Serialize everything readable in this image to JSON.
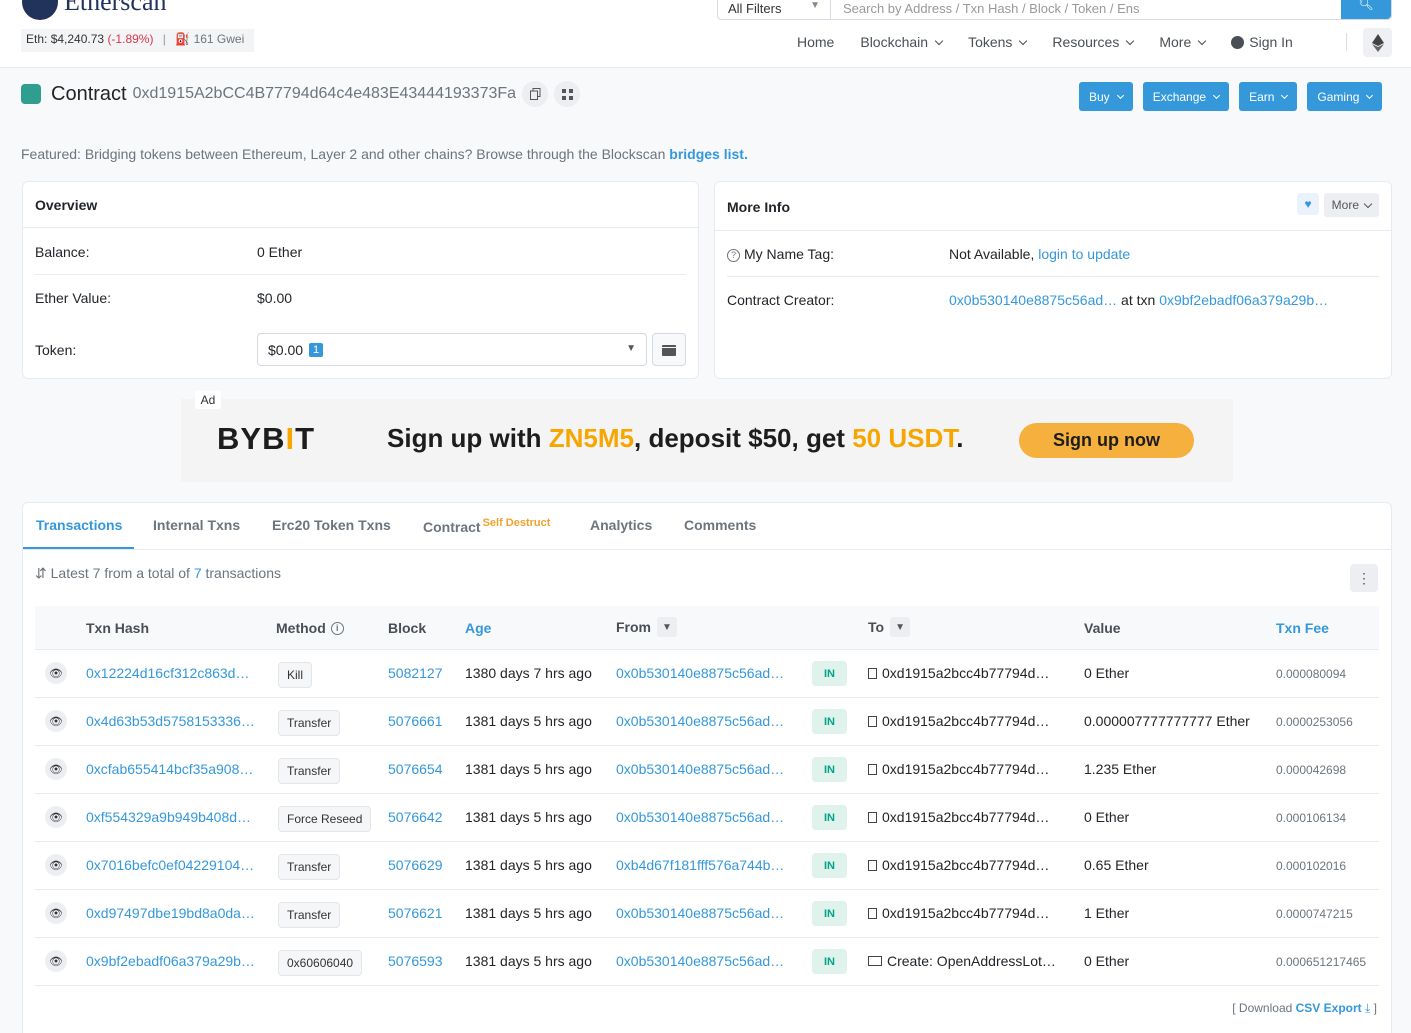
{
  "header": {
    "logo_text": "Etherscan",
    "eth_price_label": "Eth:",
    "eth_price": "$4,240.73",
    "eth_change": "(-1.89%)",
    "gas": "161 Gwei",
    "search_filter": "All Filters",
    "search_placeholder": "Search by Address / Txn Hash / Block / Token / Ens",
    "nav": [
      "Home",
      "Blockchain",
      "Tokens",
      "Resources",
      "More",
      "Sign In"
    ]
  },
  "page": {
    "title_label": "Contract",
    "address": "0xd1915A2bCC4B77794d64c4e483E43444193373Fa",
    "buttons": [
      "Buy",
      "Exchange",
      "Earn",
      "Gaming"
    ],
    "featured_text": "Featured: Bridging tokens between Ethereum, Layer 2 and other chains? Browse through the Blockscan",
    "featured_link": "bridges list."
  },
  "overview": {
    "title": "Overview",
    "balance_label": "Balance:",
    "balance": "0 Ether",
    "ether_value_label": "Ether Value:",
    "ether_value": "$0.00",
    "token_label": "Token:",
    "token_value": "$0.00",
    "token_count": "1"
  },
  "more_info": {
    "title": "More Info",
    "more_label": "More",
    "name_tag_label": "My Name Tag:",
    "name_tag_value": "Not Available,",
    "name_tag_link": "login to update",
    "creator_label": "Contract Creator:",
    "creator_address": "0x0b530140e8875c56ad…",
    "creator_at": "at txn",
    "creator_txn": "0x9bf2ebadf06a379a29b…"
  },
  "ad": {
    "label": "Ad",
    "brand": "BYB",
    "brand_i": "I",
    "brand_t": "T",
    "headline_1": "Sign up with ",
    "headline_code": "ZN5M5",
    "headline_2": ", deposit $50, get ",
    "headline_amount": "50 USDT",
    "headline_3": ".",
    "cta": "Sign up now"
  },
  "tabs": [
    {
      "label": "Transactions",
      "active": true
    },
    {
      "label": "Internal Txns"
    },
    {
      "label": "Erc20 Token Txns"
    },
    {
      "label": "Contract",
      "sup": "Self Destruct"
    },
    {
      "label": "Analytics"
    },
    {
      "label": "Comments"
    }
  ],
  "summary": {
    "prefix": "Latest 7 from a total of",
    "count": "7",
    "suffix": "transactions"
  },
  "table": {
    "headers": {
      "hash": "Txn Hash",
      "method": "Method",
      "block": "Block",
      "age": "Age",
      "from": "From",
      "to": "To",
      "value": "Value",
      "fee": "Txn Fee"
    },
    "rows": [
      {
        "hash": "0x12224d16cf312c863d…",
        "method": "Kill",
        "block": "5082127",
        "age": "1380 days 7 hrs ago",
        "from": "0x0b530140e8875c56ad…",
        "dir": "IN",
        "to": "0xd1915a2bcc4b77794d…",
        "value": "0 Ether",
        "fee": "0.000080094"
      },
      {
        "hash": "0x4d63b53d5758153336…",
        "method": "Transfer",
        "block": "5076661",
        "age": "1381 days 5 hrs ago",
        "from": "0x0b530140e8875c56ad…",
        "dir": "IN",
        "to": "0xd1915a2bcc4b77794d…",
        "value": "0.000007777777777 Ether",
        "fee": "0.0000253056"
      },
      {
        "hash": "0xcfab655414bcf35a908…",
        "method": "Transfer",
        "block": "5076654",
        "age": "1381 days 5 hrs ago",
        "from": "0x0b530140e8875c56ad…",
        "dir": "IN",
        "to": "0xd1915a2bcc4b77794d…",
        "value": "1.235 Ether",
        "fee": "0.000042698"
      },
      {
        "hash": "0xf554329a9b949b408d…",
        "method": "Force Reseed",
        "block": "5076642",
        "age": "1381 days 5 hrs ago",
        "from": "0x0b530140e8875c56ad…",
        "dir": "IN",
        "to": "0xd1915a2bcc4b77794d…",
        "value": "0 Ether",
        "fee": "0.000106134"
      },
      {
        "hash": "0x7016befc0ef04229104…",
        "method": "Transfer",
        "block": "5076629",
        "age": "1381 days 5 hrs ago",
        "from": "0xb4d67f181fff576a744b…",
        "dir": "IN",
        "to": "0xd1915a2bcc4b77794d…",
        "value": "0.65 Ether",
        "fee": "0.000102016"
      },
      {
        "hash": "0xd97497dbe19bd8a0da…",
        "method": "Transfer",
        "block": "5076621",
        "age": "1381 days 5 hrs ago",
        "from": "0x0b530140e8875c56ad…",
        "dir": "IN",
        "to": "0xd1915a2bcc4b77794d…",
        "value": "1 Ether",
        "fee": "0.0000747215"
      },
      {
        "hash": "0x9bf2ebadf06a379a29b…",
        "method": "0x60606040",
        "block": "5076593",
        "age": "1381 days 5 hrs ago",
        "from": "0x0b530140e8875c56ad…",
        "dir": "IN",
        "to": "Create: OpenAddressLot…",
        "to_is_create": true,
        "value": "0 Ether",
        "fee": "0.000651217465"
      }
    ]
  },
  "csv": {
    "prefix": "[ Download",
    "link": "CSV Export",
    "suffix": "]"
  },
  "colors": {
    "primary": "#3498db",
    "negative": "#dc3545",
    "in_badge_bg": "#dff3ec",
    "in_badge_text": "#00a186",
    "ad_accent": "#f7a600"
  }
}
